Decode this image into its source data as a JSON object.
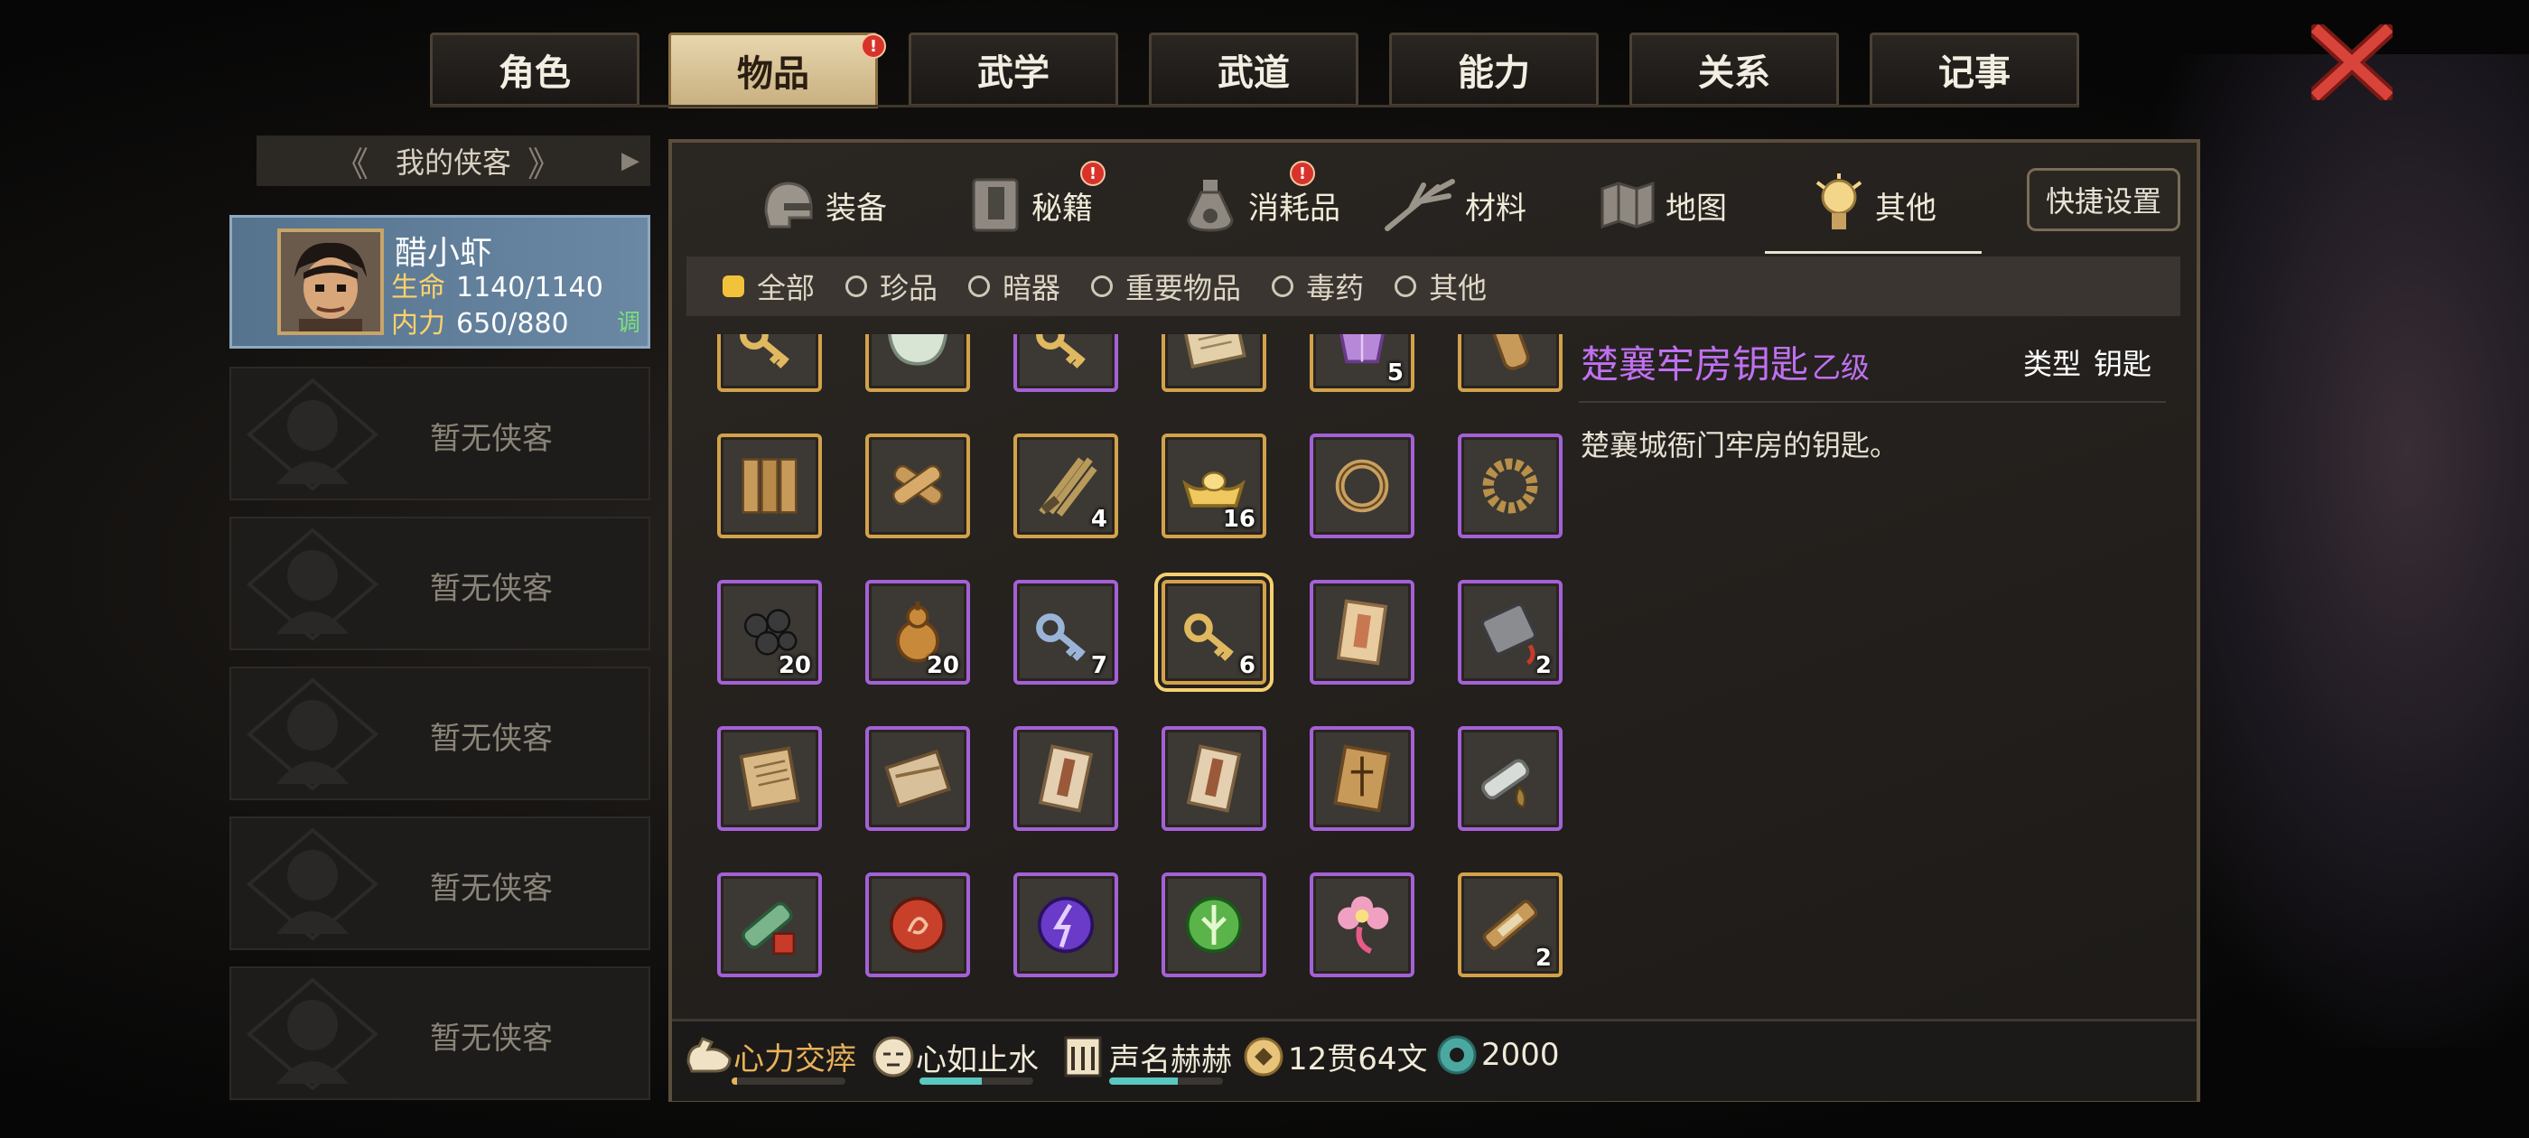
{
  "top_tabs": [
    {
      "label": "角色",
      "active": false,
      "badge": false
    },
    {
      "label": "物品",
      "active": true,
      "badge": true
    },
    {
      "label": "武学",
      "active": false,
      "badge": false
    },
    {
      "label": "武道",
      "active": false,
      "badge": false
    },
    {
      "label": "能力",
      "active": false,
      "badge": false
    },
    {
      "label": "关系",
      "active": false,
      "badge": false
    },
    {
      "label": "记事",
      "active": false,
      "badge": false
    }
  ],
  "badge_text": "!",
  "left_panel": {
    "header": "我的侠客",
    "hero": {
      "name": "醋小虾",
      "hp_label": "生命",
      "hp_value": "1140/1140",
      "mp_label": "内力",
      "mp_value": "650/880",
      "tune_label": "调"
    },
    "empty_slots": [
      "暂无侠客",
      "暂无侠客",
      "暂无侠客",
      "暂无侠客",
      "暂无侠客"
    ]
  },
  "sub_tabs": [
    {
      "label": "装备",
      "icon": "helmet-icon",
      "badge": false
    },
    {
      "label": "秘籍",
      "icon": "book-icon",
      "badge": true
    },
    {
      "label": "消耗品",
      "icon": "potion-icon",
      "badge": true
    },
    {
      "label": "材料",
      "icon": "herb-icon",
      "badge": false
    },
    {
      "label": "地图",
      "icon": "map-icon",
      "badge": false
    },
    {
      "label": "其他",
      "icon": "lamp-icon",
      "badge": false,
      "active": true
    }
  ],
  "quick_settings": "快捷设置",
  "filters": [
    {
      "label": "全部",
      "selected": true
    },
    {
      "label": "珍品",
      "selected": false
    },
    {
      "label": "暗器",
      "selected": false
    },
    {
      "label": "重要物品",
      "selected": false
    },
    {
      "label": "毒药",
      "selected": false
    },
    {
      "label": "其他",
      "selected": false
    }
  ],
  "items": [
    {
      "icon": "key-icon",
      "rarity": "gold",
      "count": ""
    },
    {
      "icon": "bowl-icon",
      "rarity": "gold",
      "count": ""
    },
    {
      "icon": "key-icon",
      "rarity": "purple",
      "count": ""
    },
    {
      "icon": "scroll-icon",
      "rarity": "gold",
      "count": ""
    },
    {
      "icon": "crystal-icon",
      "rarity": "gold",
      "count": "5"
    },
    {
      "icon": "log-icon",
      "rarity": "gold",
      "count": ""
    },
    {
      "icon": "planks-icon",
      "rarity": "gold",
      "count": ""
    },
    {
      "icon": "crossed-logs-icon",
      "rarity": "gold",
      "count": ""
    },
    {
      "icon": "rods-icon",
      "rarity": "gold",
      "count": "4"
    },
    {
      "icon": "gold-ingot-icon",
      "rarity": "gold",
      "count": "16"
    },
    {
      "icon": "ring-icon",
      "rarity": "purple",
      "count": ""
    },
    {
      "icon": "wreath-icon",
      "rarity": "purple",
      "count": ""
    },
    {
      "icon": "iron-balls-icon",
      "rarity": "purple",
      "count": "20"
    },
    {
      "icon": "gourd-icon",
      "rarity": "purple",
      "count": "20"
    },
    {
      "icon": "silver-key-icon",
      "rarity": "purple",
      "count": "7"
    },
    {
      "icon": "key-icon",
      "rarity": "gold",
      "count": "6",
      "selected": true
    },
    {
      "icon": "paper-icon",
      "rarity": "purple",
      "count": ""
    },
    {
      "icon": "token-icon",
      "rarity": "purple",
      "count": "2"
    },
    {
      "icon": "book-icon",
      "rarity": "purple",
      "count": ""
    },
    {
      "icon": "package-icon",
      "rarity": "purple",
      "count": ""
    },
    {
      "icon": "letter-icon",
      "rarity": "purple",
      "count": ""
    },
    {
      "icon": "letter-icon",
      "rarity": "purple",
      "count": ""
    },
    {
      "icon": "sealed-book-icon",
      "rarity": "purple",
      "count": ""
    },
    {
      "icon": "scroll-bag-icon",
      "rarity": "purple",
      "count": ""
    },
    {
      "icon": "gift-scroll-icon",
      "rarity": "purple",
      "count": ""
    },
    {
      "icon": "red-orb-icon",
      "rarity": "purple",
      "count": ""
    },
    {
      "icon": "purple-orb-icon",
      "rarity": "purple",
      "count": ""
    },
    {
      "icon": "green-orb-icon",
      "rarity": "purple",
      "count": ""
    },
    {
      "icon": "flower-icon",
      "rarity": "purple",
      "count": ""
    },
    {
      "icon": "bamboo-scroll-icon",
      "rarity": "gold",
      "count": "2"
    }
  ],
  "detail": {
    "name": "楚襄牢房钥匙",
    "grade": "乙级",
    "type_label": "类型",
    "type_value": "钥匙",
    "description": "楚襄城衙门牢房的钥匙。"
  },
  "status_bar": {
    "stamina": {
      "label": "心力交瘁",
      "fill": 0.05
    },
    "mood": {
      "label": "心如止水",
      "fill": 0.55
    },
    "fame": {
      "label": "声名赫赫",
      "fill": 0.6
    },
    "money": "12贯64文",
    "points": "2000"
  },
  "colors": {
    "gold": "#d2a24a",
    "purple": "#a461d6",
    "title_purple": "#c070f0",
    "active_tab": "#d8c49a"
  }
}
